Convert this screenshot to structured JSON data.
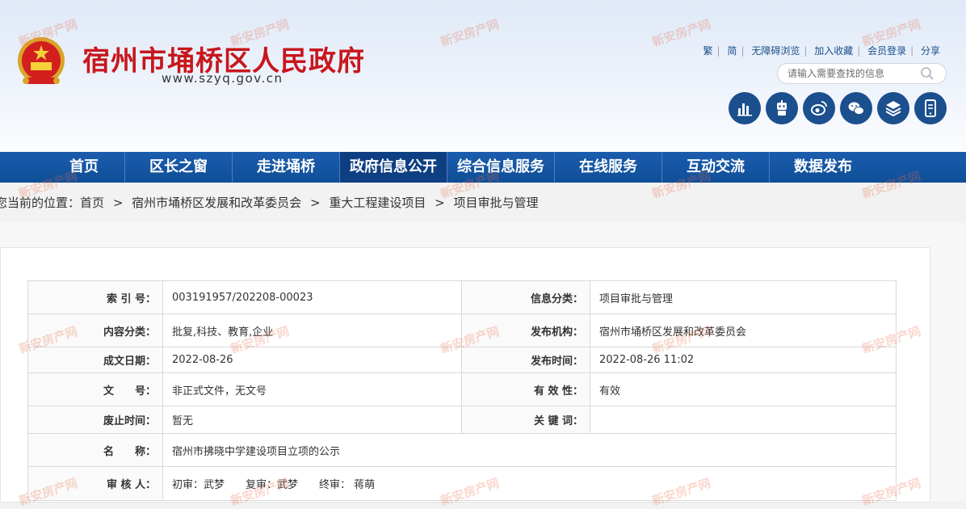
{
  "header": {
    "title": "宿州市埇桥区人民政府",
    "url": "www.szyq.gov.cn",
    "toplinks": [
      "繁",
      "简",
      "无障碍浏览",
      "加入收藏",
      "会员登录",
      "分享"
    ],
    "search_placeholder": "请输入需要查找的信息",
    "icon_names": [
      "bar-chart-icon",
      "robot-icon",
      "weibo-icon",
      "wechat-icon",
      "layers-icon",
      "mobile-icon"
    ]
  },
  "nav": {
    "items": [
      "首页",
      "区长之窗",
      "走进埇桥",
      "政府信息公开",
      "综合信息服务",
      "在线服务",
      "互动交流",
      "数据发布"
    ],
    "active": "政府信息公开"
  },
  "breadcrumb": {
    "prefix": "您当前的位置：",
    "items": [
      "首页",
      "宿州市埇桥区发展和改革委员会",
      "重大工程建设项目",
      "项目审批与管理"
    ],
    "separator": ">"
  },
  "info": {
    "index_label": "索 引 号：",
    "index_value": "003191957/202208-00023",
    "category_label": "信息分类：",
    "category_value": "项目审批与管理",
    "content_label": "内容分类：",
    "content_value": "批复,科技、教育,企业",
    "publisher_label": "发布机构：",
    "publisher_value": "宿州市埇桥区发展和改革委员会",
    "date_label": "成文日期：",
    "date_value": "2022-08-26",
    "pubtime_label": "发布时间：",
    "pubtime_value": "2022-08-26 11:02",
    "docno_label": "文　　号：",
    "docno_value": "非正式文件，无文号",
    "validity_label": "有 效 性：",
    "validity_value": "有效",
    "abolish_label": "废止时间：",
    "abolish_value": "暂无",
    "keywords_label": "关 键 词：",
    "keywords_value": "",
    "name_label": "名　　称：",
    "name_value": "宿州市拂晓中学建设项目立项的公示",
    "reviewer_label": "审 核 人：",
    "reviewer_value": "初审：武梦　　复审：武梦　　终审： 蒋萌"
  },
  "watermark": "新安房产网",
  "colors": {
    "brand_red": "#c8161d",
    "nav_blue": "#0f4f97",
    "icon_blue": "#1b4f8d"
  }
}
